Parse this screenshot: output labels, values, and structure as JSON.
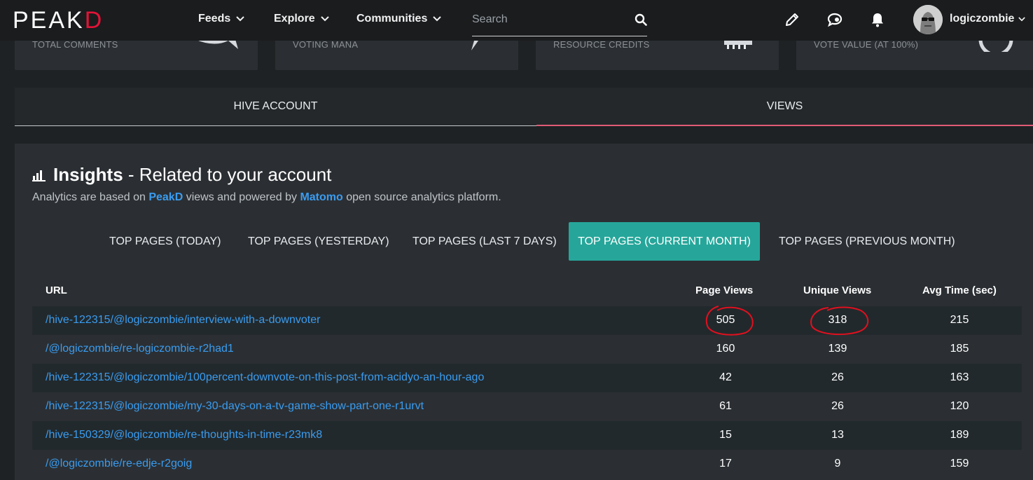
{
  "nav": {
    "logo_prefix": "PE",
    "logo_a": "A",
    "logo_suffix": "K",
    "logo_d": "D",
    "links": [
      "Feeds",
      "Explore",
      "Communities"
    ],
    "search_placeholder": "Search",
    "username": "logiczombie"
  },
  "stat_cards": [
    "TOTAL COMMENTS",
    "VOTING MANA",
    "RESOURCE CREDITS",
    "VOTE VALUE (AT 100%)"
  ],
  "account_tabs": [
    "HIVE ACCOUNT",
    "VIEWS"
  ],
  "insights": {
    "title_bold": "Insights",
    "title_rest": " - Related to your account",
    "subtitle_pre": "Analytics are based on ",
    "subtitle_link1": "PeakD",
    "subtitle_mid": " views and powered by ",
    "subtitle_link2": "Matomo",
    "subtitle_post": " open source analytics platform."
  },
  "page_tabs": [
    "TOP PAGES (TODAY)",
    "TOP PAGES (YESTERDAY)",
    "TOP PAGES (LAST 7 DAYS)",
    "TOP PAGES (CURRENT MONTH)",
    "TOP PAGES (PREVIOUS MONTH)"
  ],
  "active_page_tab": "TOP PAGES (CURRENT MONTH)",
  "table": {
    "headers": [
      "URL",
      "Page Views",
      "Unique Views",
      "Avg Time (sec)"
    ],
    "rows": [
      {
        "url": "/hive-122315/@logiczombie/interview-with-a-downvoter",
        "page_views": "505",
        "unique_views": "318",
        "avg_time": "215"
      },
      {
        "url": "/@logiczombie/re-logiczombie-r2had1",
        "page_views": "160",
        "unique_views": "139",
        "avg_time": "185"
      },
      {
        "url": "/hive-122315/@logiczombie/100percent-downvote-on-this-post-from-acidyo-an-hour-ago",
        "page_views": "42",
        "unique_views": "26",
        "avg_time": "163"
      },
      {
        "url": "/hive-122315/@logiczombie/my-30-days-on-a-tv-game-show-part-one-r1urvt",
        "page_views": "61",
        "unique_views": "26",
        "avg_time": "120"
      },
      {
        "url": "/hive-150329/@logiczombie/re-thoughts-in-time-r23mk8",
        "page_views": "15",
        "unique_views": "13",
        "avg_time": "189"
      },
      {
        "url": "/@logiczombie/re-edje-r2goig",
        "page_views": "17",
        "unique_views": "9",
        "avg_time": "159"
      }
    ]
  },
  "colors": {
    "accent_red": "#e31337",
    "active_tab": "#26a69a",
    "link": "#3a9cf0",
    "annotation": "#e0101f"
  }
}
